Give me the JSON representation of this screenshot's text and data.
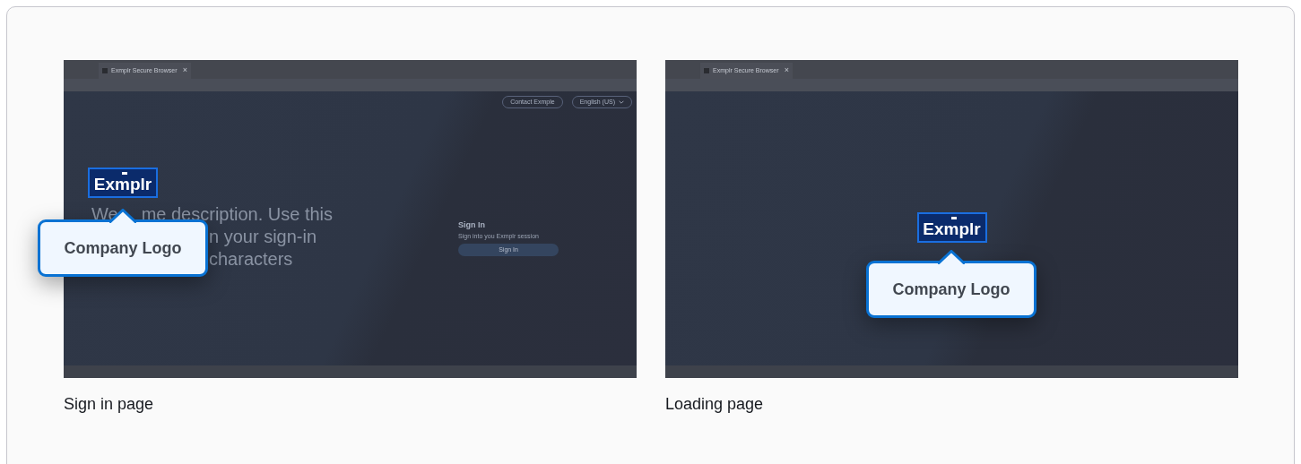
{
  "cards": [
    {
      "caption": "Sign in page",
      "callout": "Company Logo",
      "screen": {
        "kind": "sign_in",
        "tab": {
          "title": "Exmplr Secure Browser",
          "close": "×"
        },
        "logo": "Exmplr",
        "header_buttons": [
          {
            "label": "Contact Exmple",
            "dropdown": false
          },
          {
            "label": "English (US)",
            "dropdown": true
          }
        ],
        "welcome": [
          {
            "parts": [
              "We",
              "me description. Use this"
            ]
          },
          {
            "parts": [
              "n your sign-in"
            ]
          },
          {
            "parts": [
              "characters"
            ]
          }
        ],
        "sign_in": {
          "title": "Sign In",
          "subtitle": "Sign into you Exmplr session",
          "button": "Sign In"
        }
      }
    },
    {
      "caption": "Loading page",
      "callout": "Company Logo",
      "screen": {
        "kind": "loading",
        "tab": {
          "title": "Exmplr Secure Browser",
          "close": "×"
        },
        "logo": "Exmplr"
      }
    }
  ]
}
